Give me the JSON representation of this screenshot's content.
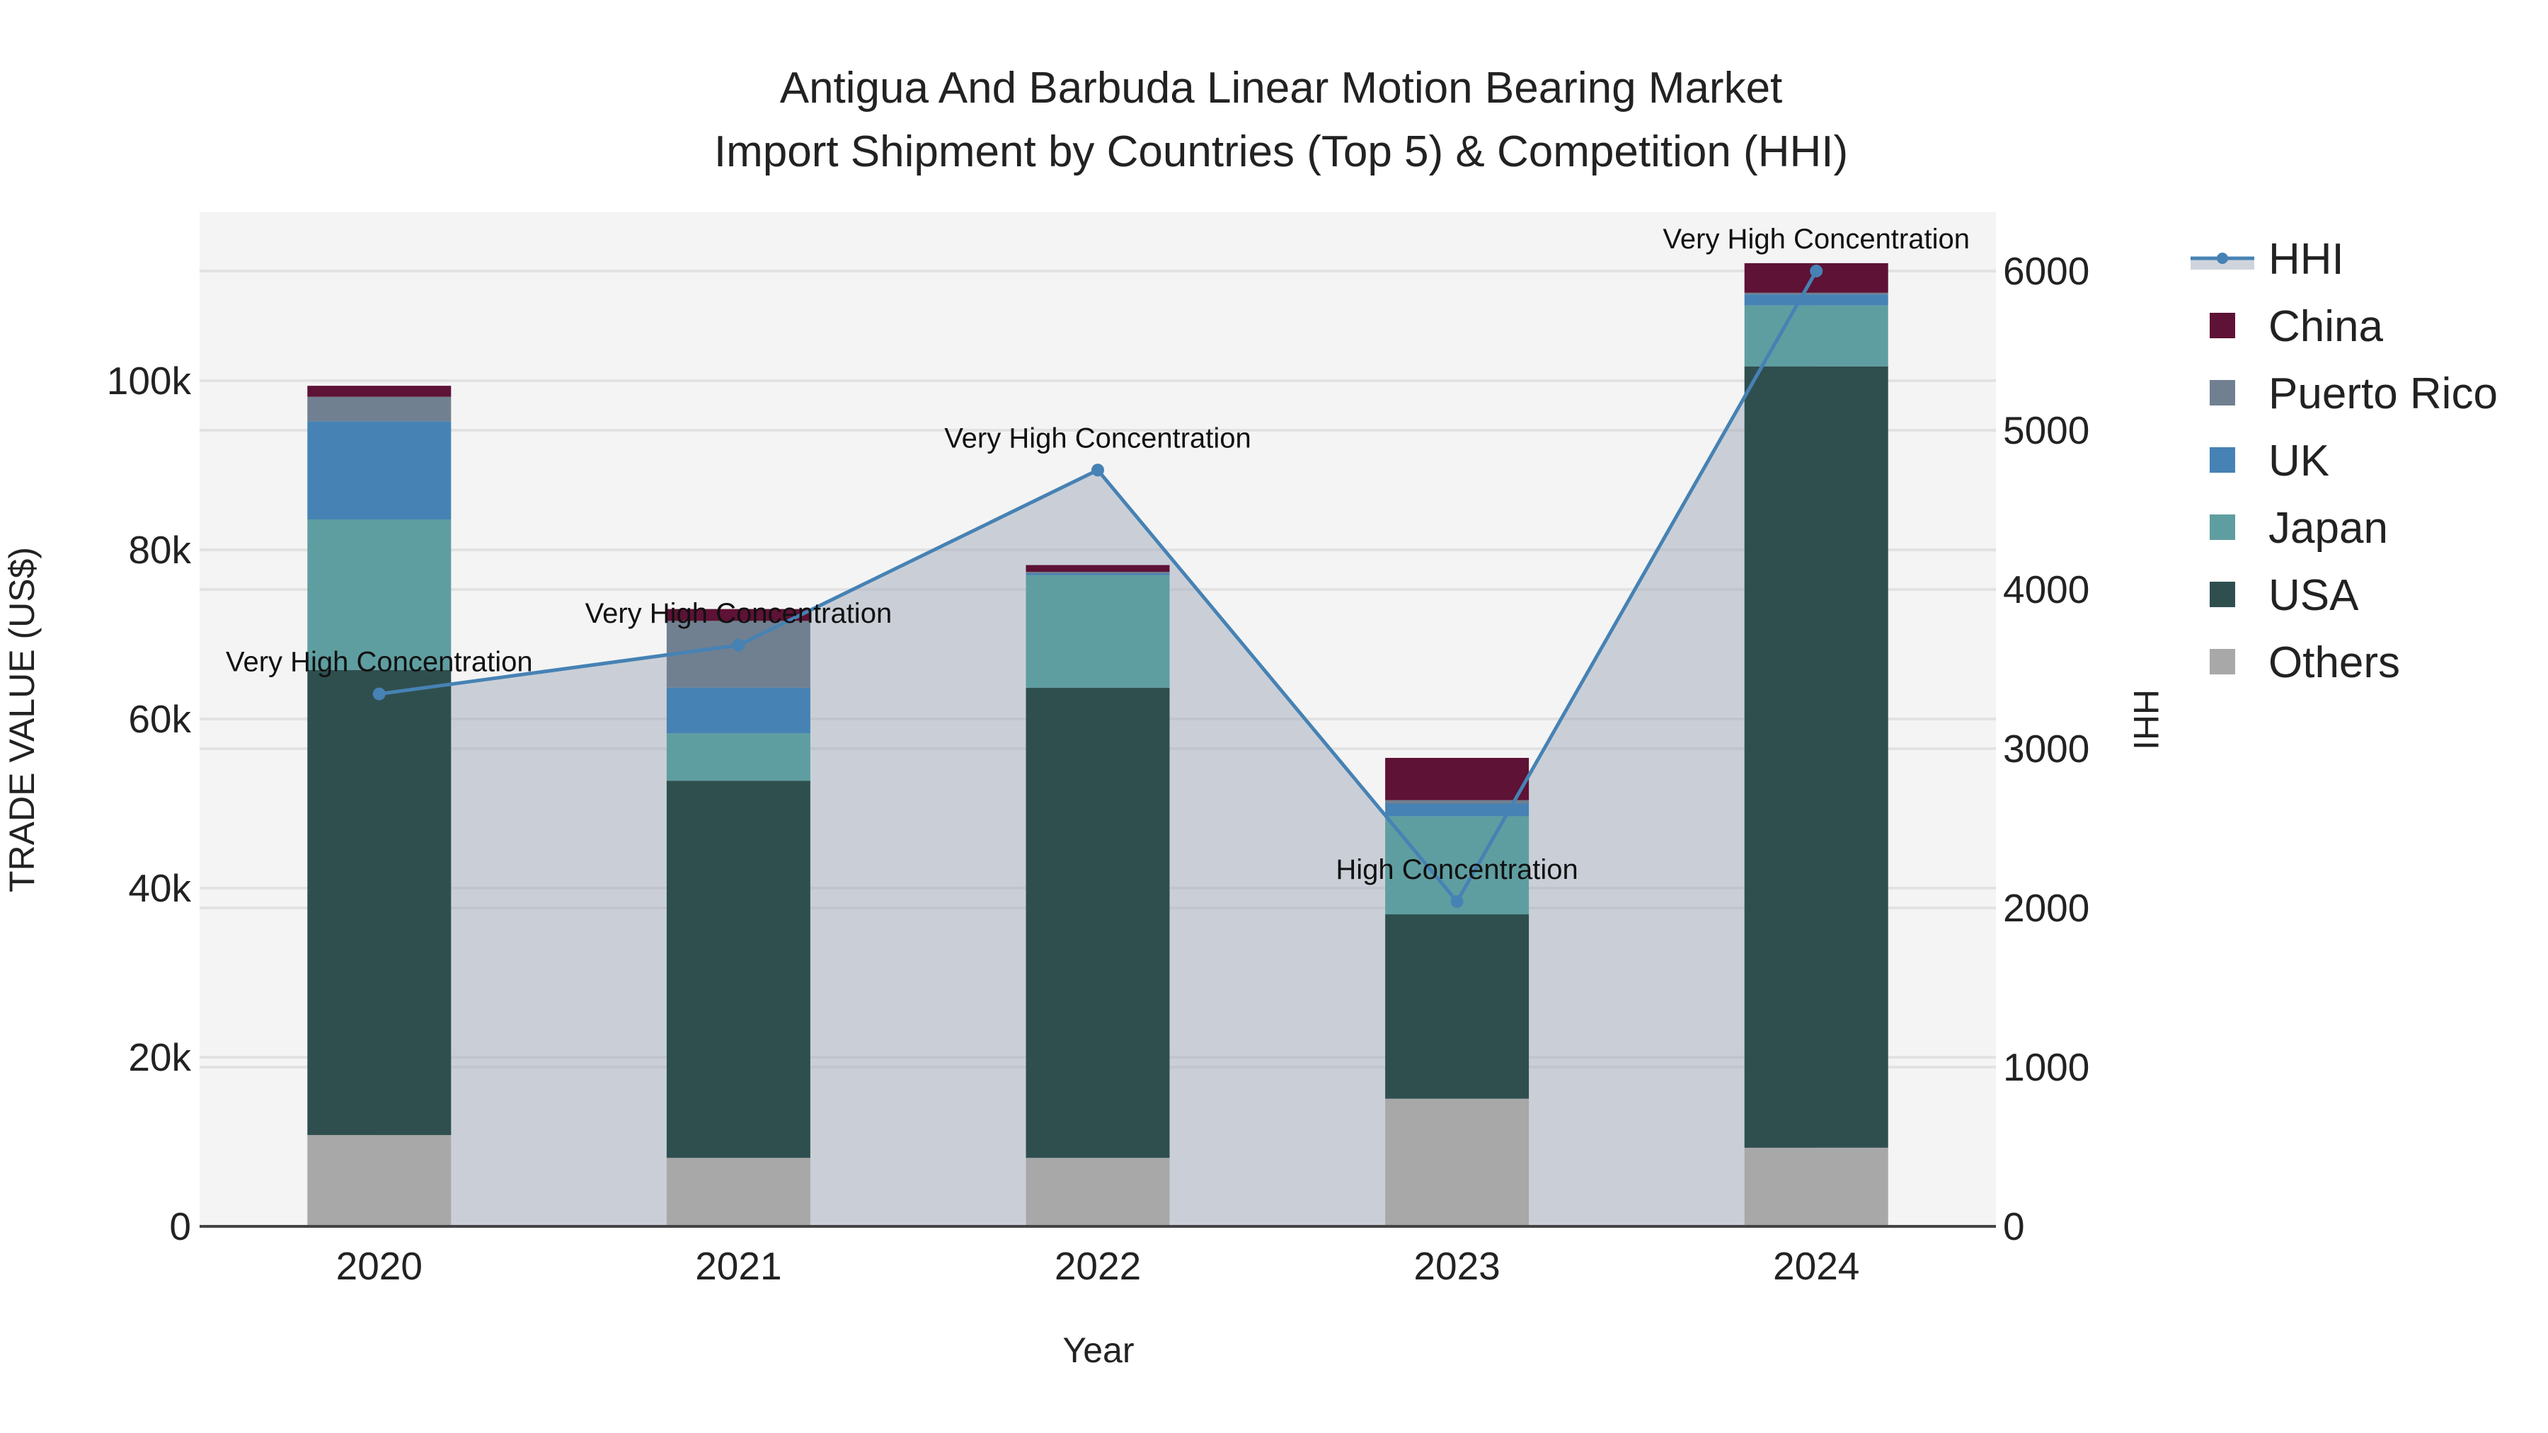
{
  "chart_data": {
    "type": "bar",
    "title": "Antigua And Barbuda Linear Motion Bearing Market",
    "subtitle": "Import Shipment by Countries (Top 5) & Competition (HHI)",
    "xlabel": "Year",
    "ylabel": "TRADE VALUE (US$)",
    "y2label": "HHI",
    "categories": [
      "2020",
      "2021",
      "2022",
      "2023",
      "2024"
    ],
    "ylim": [
      0,
      120000
    ],
    "y2lim": [
      0,
      6360
    ],
    "yticks": [
      0,
      20000,
      40000,
      60000,
      80000,
      100000
    ],
    "ytick_labels": [
      "0",
      "20k",
      "40k",
      "60k",
      "80k",
      "100k"
    ],
    "y2ticks": [
      0,
      1000,
      2000,
      3000,
      4000,
      5000,
      6000
    ],
    "y2tick_labels": [
      "0",
      "1000",
      "2000",
      "3000",
      "4000",
      "5000",
      "6000"
    ],
    "grid": true,
    "legend_position": "right",
    "series": [
      {
        "name": "Others",
        "color": "#a8a8a8",
        "values": [
          10800,
          8100,
          8100,
          15100,
          9300
        ]
      },
      {
        "name": "USA",
        "color": "#2f4f4f",
        "values": [
          55000,
          44600,
          55600,
          21800,
          92400
        ]
      },
      {
        "name": "Japan",
        "color": "#5f9ea0",
        "values": [
          17800,
          5600,
          13300,
          11600,
          7200
        ]
      },
      {
        "name": "UK",
        "color": "#4682b4",
        "values": [
          11600,
          5400,
          200,
          1500,
          1300
        ]
      },
      {
        "name": "Puerto Rico",
        "color": "#708090",
        "values": [
          2900,
          7900,
          200,
          400,
          200
        ]
      },
      {
        "name": "China",
        "color": "#5e1235",
        "values": [
          1300,
          1400,
          800,
          5000,
          3500
        ]
      }
    ],
    "hhi": {
      "name": "HHI",
      "color": "#4682b4",
      "values": [
        3344,
        3650,
        4750,
        2040,
        6000
      ],
      "labels": [
        "Very High Concentration",
        "Very High Concentration",
        "Very High Concentration",
        "High Concentration",
        "Very High Concentration"
      ]
    }
  }
}
